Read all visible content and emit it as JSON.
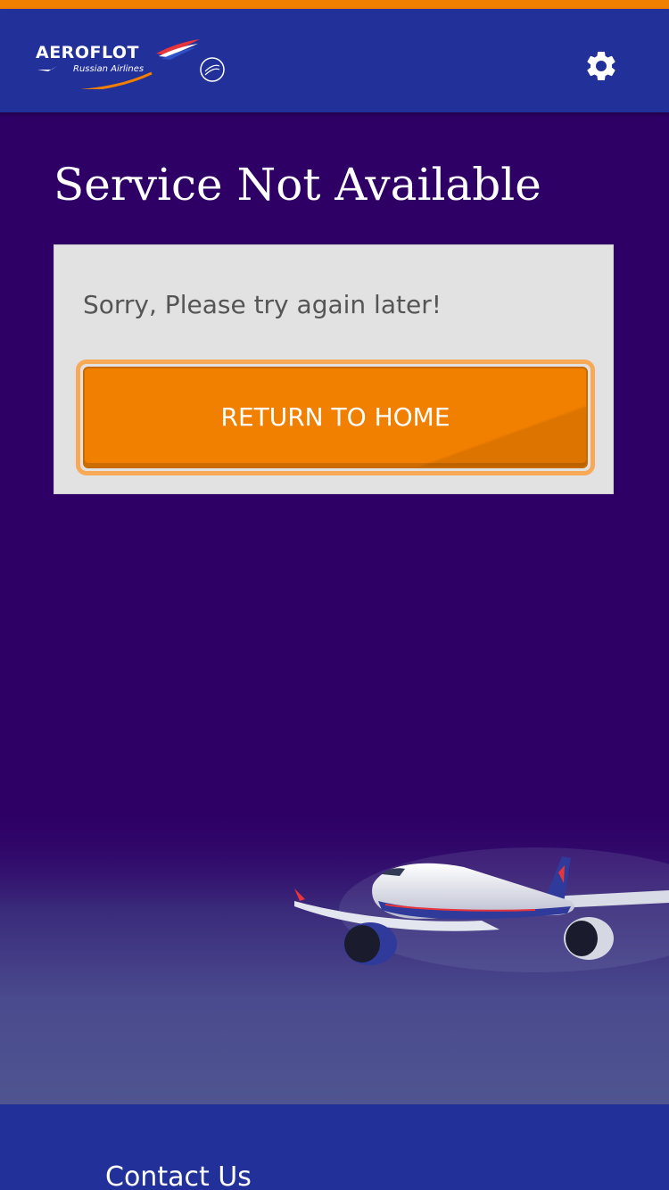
{
  "header": {
    "brand_name": "AEROFLOT",
    "brand_tagline": "Russian Airlines",
    "settings_icon": "gear-icon"
  },
  "main": {
    "title": "Service Not Available",
    "message": "Sorry, Please try again later!",
    "return_button_label": "RETURN TO HOME"
  },
  "footer": {
    "contact_label": "Contact Us"
  },
  "colors": {
    "accent_orange": "#f17f00",
    "header_blue": "#22309a",
    "background_purple": "#2e0066",
    "card_gray": "#e2e2e2"
  }
}
